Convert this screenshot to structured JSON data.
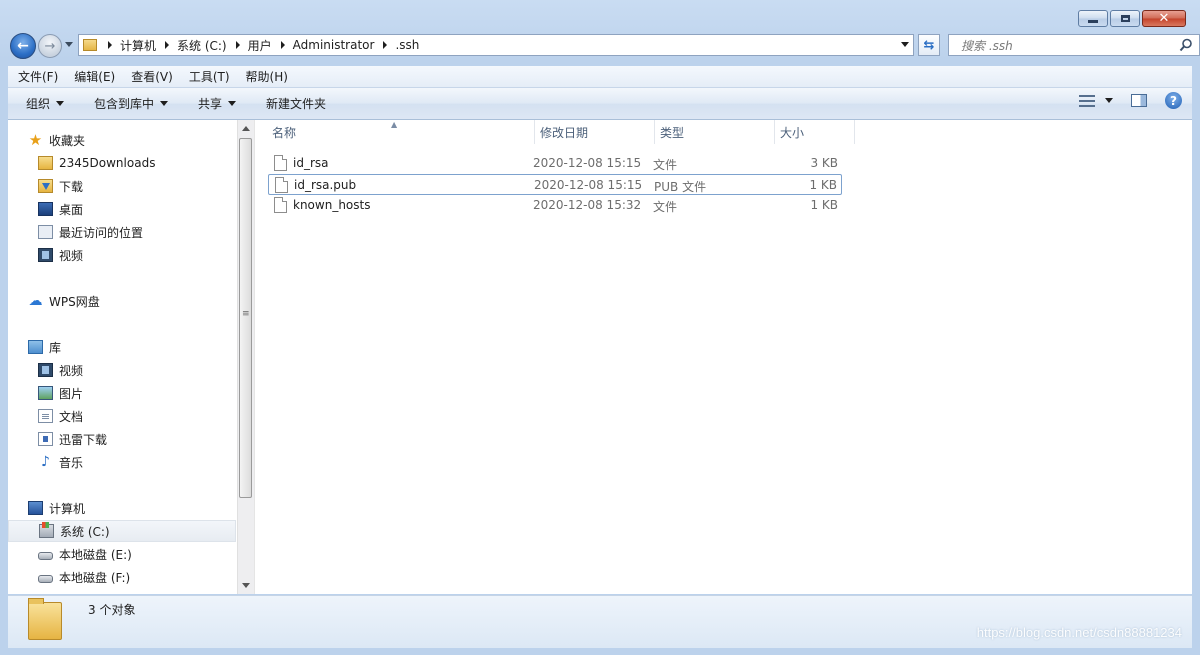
{
  "address_bar": {
    "crumbs": [
      "计算机",
      "系统 (C:)",
      "用户",
      "Administrator",
      ".ssh"
    ]
  },
  "search": {
    "placeholder": "搜索 .ssh"
  },
  "menubar": [
    "文件(F)",
    "编辑(E)",
    "查看(V)",
    "工具(T)",
    "帮助(H)"
  ],
  "toolbar": {
    "organize": "组织",
    "include_in_library": "包含到库中",
    "share": "共享",
    "new_folder": "新建文件夹"
  },
  "nav": {
    "favorites": {
      "label": "收藏夹",
      "items": [
        "2345Downloads",
        "下载",
        "桌面",
        "最近访问的位置",
        "视频"
      ]
    },
    "wps": {
      "label": "WPS网盘"
    },
    "library": {
      "label": "库",
      "items": [
        "视频",
        "图片",
        "文档",
        "迅雷下载",
        "音乐"
      ]
    },
    "computer": {
      "label": "计算机",
      "items": [
        "系统 (C:)",
        "本地磁盘 (E:)",
        "本地磁盘 (F:)"
      ]
    }
  },
  "columns": {
    "name": "名称",
    "date": "修改日期",
    "type": "类型",
    "size": "大小"
  },
  "files": [
    {
      "name": "id_rsa",
      "date": "2020-12-08 15:15",
      "type": "文件",
      "size": "3 KB"
    },
    {
      "name": "id_rsa.pub",
      "date": "2020-12-08 15:15",
      "type": "PUB 文件",
      "size": "1 KB"
    },
    {
      "name": "known_hosts",
      "date": "2020-12-08 15:32",
      "type": "文件",
      "size": "1 KB"
    }
  ],
  "status": {
    "count_text": "3 个对象"
  },
  "watermark": "https://blog.csdn.net/csdn88881234"
}
